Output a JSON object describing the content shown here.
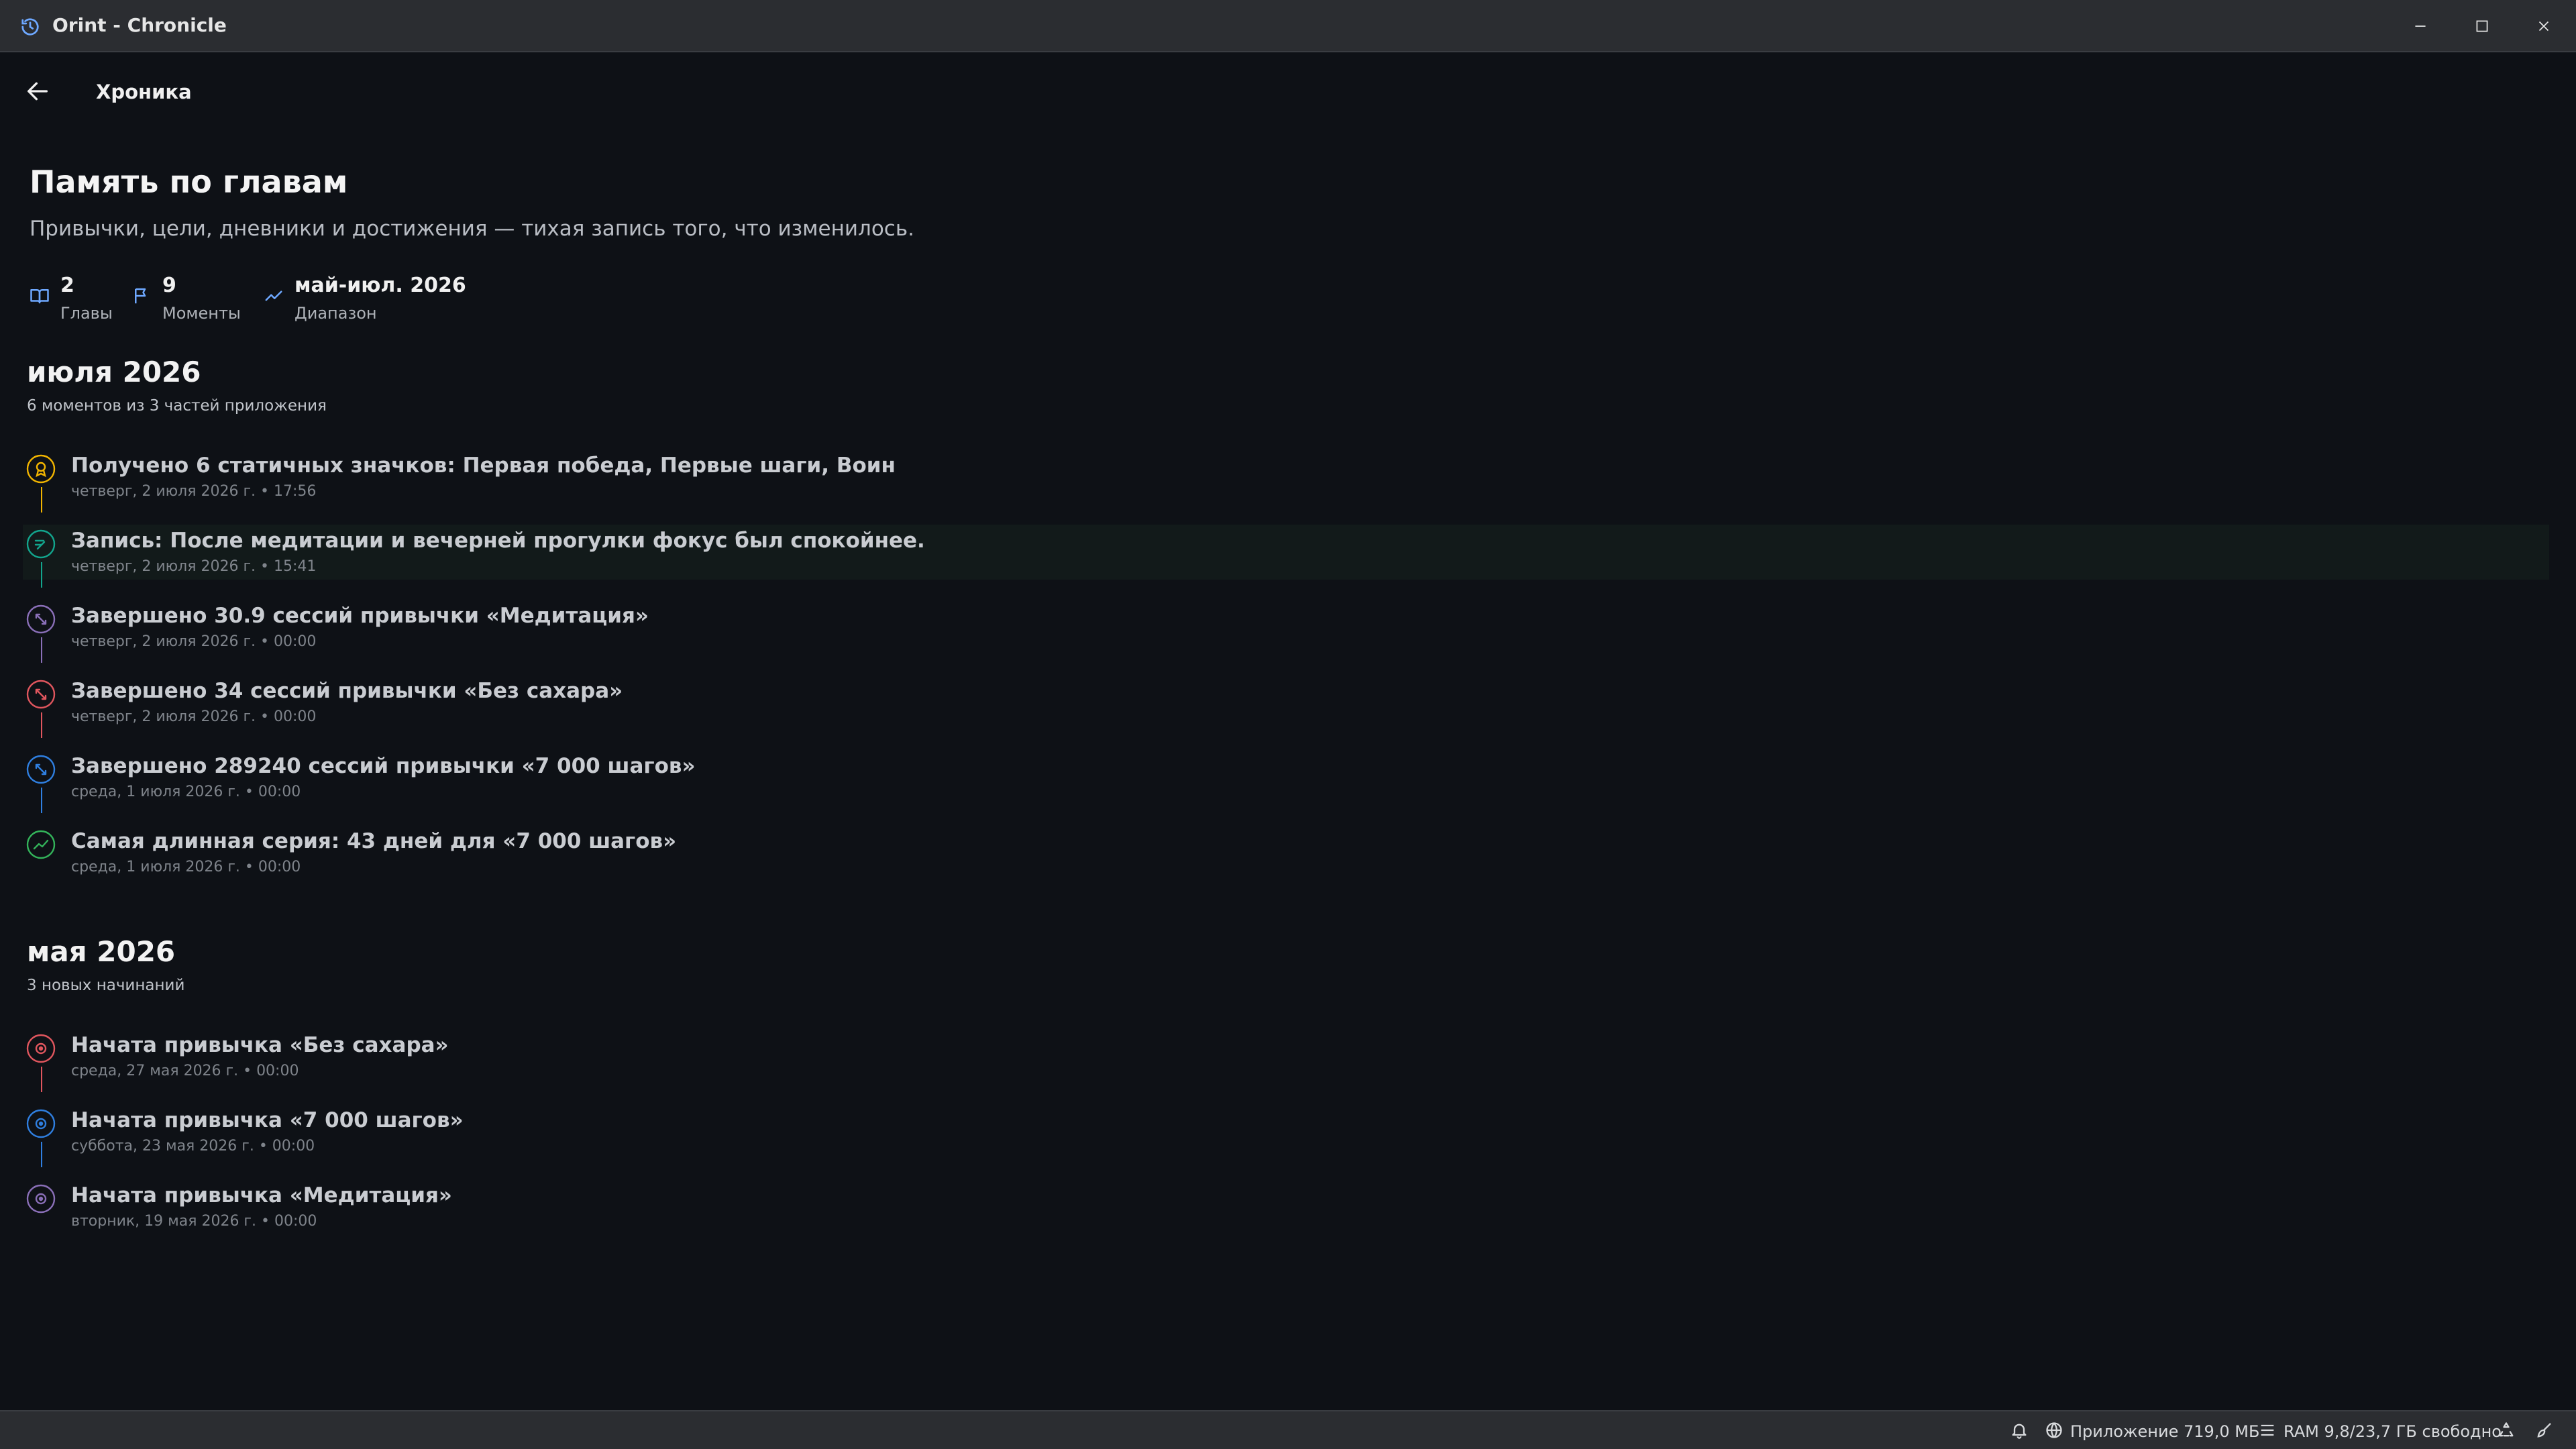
{
  "window": {
    "title": "Orint - Chronicle",
    "icons": {
      "app": "history-icon",
      "minimize": "minimize-icon",
      "maximize": "maximize-icon",
      "close": "close-icon"
    }
  },
  "header": {
    "back_icon": "arrow-left-icon",
    "title": "Хроника"
  },
  "page": {
    "title": "Память по главам",
    "subtitle": "Привычки, цели, дневники и достижения — тихая запись того, что изменилось."
  },
  "stats": [
    {
      "icon": "book-open-icon",
      "value": "2",
      "label": "Главы"
    },
    {
      "icon": "flag-icon",
      "value": "9",
      "label": "Моменты"
    },
    {
      "icon": "trend-icon",
      "value": "май-июл. 2026",
      "label": "Диапазон"
    }
  ],
  "chapters": [
    {
      "title": "июля 2026",
      "summary": "6 моментов из 3 частей приложения",
      "moments": [
        {
          "icon": "badge-icon",
          "color": "#f1b400",
          "title": "Получено 6 статичных значков: Первая победа, Первые шаги, Воин",
          "meta": "четверг, 2 июля 2026 г. • 17:56",
          "highlighted": false
        },
        {
          "icon": "journal-icon",
          "color": "#12a58d",
          "title": "Запись: После медитации и вечерней прогулки фокус был спокойнее.",
          "meta": "четверг, 2 июля 2026 г. • 15:41",
          "highlighted": true
        },
        {
          "icon": "repeat-icon",
          "color": "#8a6fb8",
          "title": "Завершено 30.9 сессий привычки «Медитация»",
          "meta": "четверг, 2 июля 2026 г. • 00:00",
          "highlighted": false
        },
        {
          "icon": "repeat-icon",
          "color": "#e0565e",
          "title": "Завершено 34 сессий привычки «Без сахара»",
          "meta": "четверг, 2 июля 2026 г. • 00:00",
          "highlighted": false
        },
        {
          "icon": "repeat-icon",
          "color": "#2f7fe0",
          "title": "Завершено 289240 сессий привычки «7 000 шагов»",
          "meta": "среда, 1 июля 2026 г. • 00:00",
          "highlighted": false
        },
        {
          "icon": "trend-icon",
          "color": "#33b35a",
          "title": "Самая длинная серия: 43 дней для «7 000 шагов»",
          "meta": "среда, 1 июля 2026 г. • 00:00",
          "highlighted": false
        }
      ]
    },
    {
      "title": "мая 2026",
      "summary": "3 новых начинаний",
      "moments": [
        {
          "icon": "play-circle-icon",
          "color": "#e0565e",
          "title": "Начата привычка «Без сахара»",
          "meta": "среда, 27 мая 2026 г. • 00:00",
          "highlighted": false
        },
        {
          "icon": "play-circle-icon",
          "color": "#2f7fe0",
          "title": "Начата привычка «7 000 шагов»",
          "meta": "суббота, 23 мая 2026 г. • 00:00",
          "highlighted": false
        },
        {
          "icon": "play-circle-icon",
          "color": "#8a6fb8",
          "title": "Начата привычка «Медитация»",
          "meta": "вторник, 19 мая 2026 г. • 00:00",
          "highlighted": false
        }
      ]
    }
  ],
  "statusbar": {
    "app_memory": "Приложение 719,0 МБ",
    "ram": "RAM 9,8/23,7 ГБ свободно",
    "icons": {
      "notifications": "bell-icon",
      "app": "globe-icon",
      "ram": "memory-icon",
      "recycle": "recycle-icon",
      "tools": "broom-icon"
    }
  }
}
